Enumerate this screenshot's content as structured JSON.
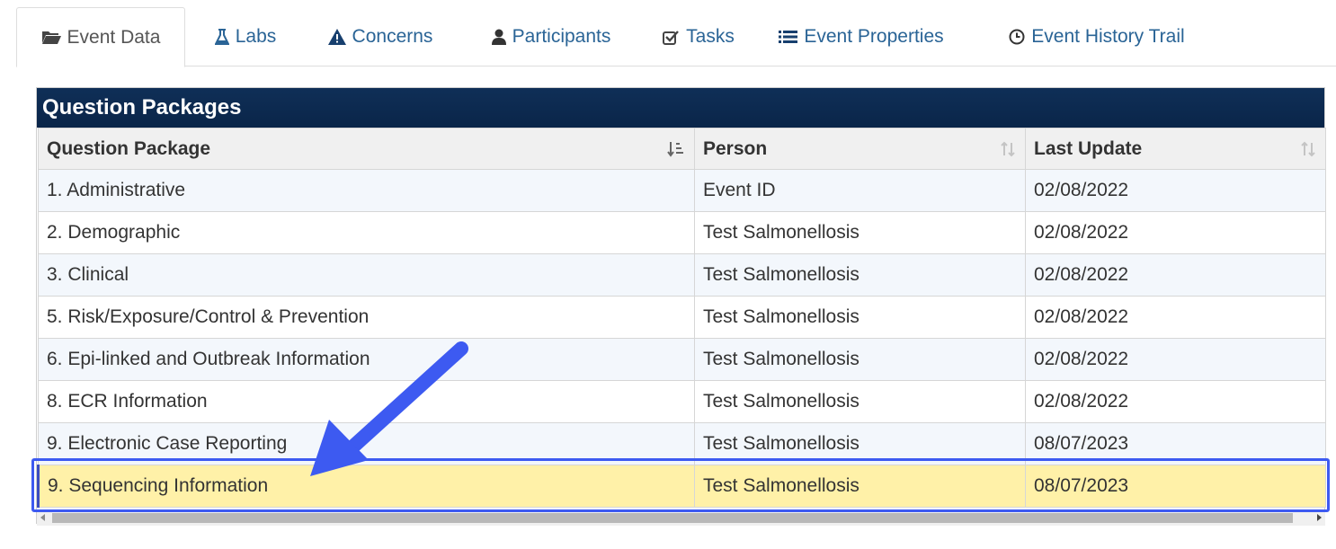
{
  "tabs": [
    {
      "label": "Event Data",
      "icon": "folder-open-icon",
      "active": true
    },
    {
      "label": "Labs",
      "icon": "flask-icon",
      "active": false
    },
    {
      "label": "Concerns",
      "icon": "warning-icon",
      "active": false
    },
    {
      "label": "Participants",
      "icon": "user-icon",
      "active": false
    },
    {
      "label": "Tasks",
      "icon": "checkbox-icon",
      "active": false
    },
    {
      "label": "Event Properties",
      "icon": "list-icon",
      "active": false
    },
    {
      "label": "Event History Trail",
      "icon": "clock-icon",
      "active": false
    }
  ],
  "panel": {
    "title": "Question Packages",
    "columns": [
      "Question Package",
      "Person",
      "Last Update"
    ],
    "rows": [
      [
        "1. Administrative",
        "Event ID",
        "02/08/2022"
      ],
      [
        "2. Demographic",
        "Test Salmonellosis",
        "02/08/2022"
      ],
      [
        "3. Clinical",
        "Test Salmonellosis",
        "02/08/2022"
      ],
      [
        "5. Risk/Exposure/Control & Prevention",
        "Test Salmonellosis",
        "02/08/2022"
      ],
      [
        "6. Epi-linked and Outbreak Information",
        "Test Salmonellosis",
        "02/08/2022"
      ],
      [
        "8. ECR Information",
        "Test Salmonellosis",
        "02/08/2022"
      ],
      [
        "9. Electronic Case Reporting",
        "Test Salmonellosis",
        "08/07/2023"
      ],
      [
        "9. Sequencing Information",
        "Test Salmonellosis",
        "08/07/2023"
      ]
    ],
    "highlighted_row": 7
  },
  "colors": {
    "header_bg": "#0f2f57",
    "highlight_row": "#fff1a8",
    "annotation": "#3d5af1",
    "link": "#2a6496"
  }
}
